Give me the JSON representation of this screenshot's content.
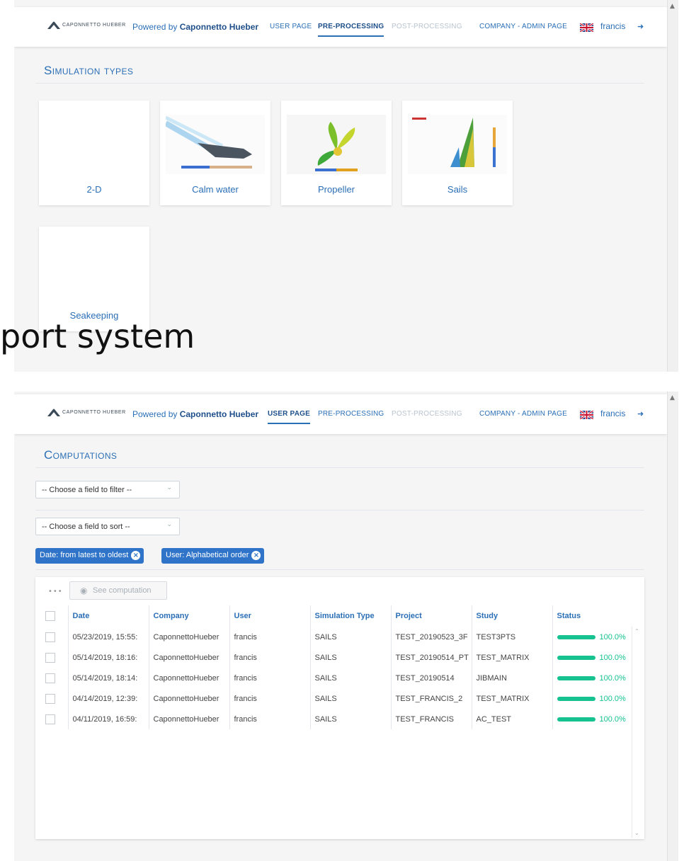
{
  "brand": {
    "logo_text": "Caponnetto Hueber",
    "powered_prefix": "Powered by",
    "powered_name": "Caponnetto Hueber"
  },
  "nav": {
    "user_page": "User page",
    "pre_processing": "Pre-processing",
    "post_processing": "Post-processing",
    "admin_page": "Company - Admin page",
    "username": "francis"
  },
  "pre_processing_view": {
    "title": "Simulation types",
    "tiles": [
      {
        "label": "2-D"
      },
      {
        "label": "Calm water"
      },
      {
        "label": "Propeller"
      },
      {
        "label": "Sails"
      },
      {
        "label": "Seakeeping"
      }
    ]
  },
  "overlay_caption": "port system",
  "user_page_view": {
    "title": "Computations",
    "filter_placeholder": "-- Choose a field to filter --",
    "sort_placeholder": "-- Choose a field to sort --",
    "chips": [
      "Date: from latest to oldest",
      "User: Alphabetical order"
    ],
    "toolbar": {
      "dots": "•••",
      "see_computation": "See computation"
    },
    "columns": [
      "Date",
      "Company",
      "User",
      "Simulation Type",
      "Project",
      "Study",
      "Status"
    ],
    "rows": [
      {
        "date": "05/23/2019, 15:55:",
        "company": "CaponnettoHueber",
        "user": "francis",
        "type": "SAILS",
        "project": "TEST_20190523_3F",
        "study": "TEST3PTS",
        "status": "100.0%",
        "progress": 1.0
      },
      {
        "date": "05/14/2019, 18:16:",
        "company": "CaponnettoHueber",
        "user": "francis",
        "type": "SAILS",
        "project": "TEST_20190514_PT",
        "study": "TEST_MATRIX",
        "status": "100.0%",
        "progress": 1.0
      },
      {
        "date": "05/14/2019, 18:14:",
        "company": "CaponnettoHueber",
        "user": "francis",
        "type": "SAILS",
        "project": "TEST_20190514",
        "study": "JIBMAIN",
        "status": "100.0%",
        "progress": 1.0
      },
      {
        "date": "04/14/2019, 12:39:",
        "company": "CaponnettoHueber",
        "user": "francis",
        "type": "SAILS",
        "project": "TEST_FRANCIS_2",
        "study": "TEST_MATRIX",
        "status": "100.0%",
        "progress": 1.0
      },
      {
        "date": "04/11/2019, 16:59:",
        "company": "CaponnettoHueber",
        "user": "francis",
        "type": "SAILS",
        "project": "TEST_FRANCIS",
        "study": "AC_TEST",
        "status": "100.0%",
        "progress": 1.0
      }
    ]
  },
  "colors": {
    "accent": "#2b6fb6",
    "chip": "#2f74c8",
    "progress": "#15c290"
  }
}
